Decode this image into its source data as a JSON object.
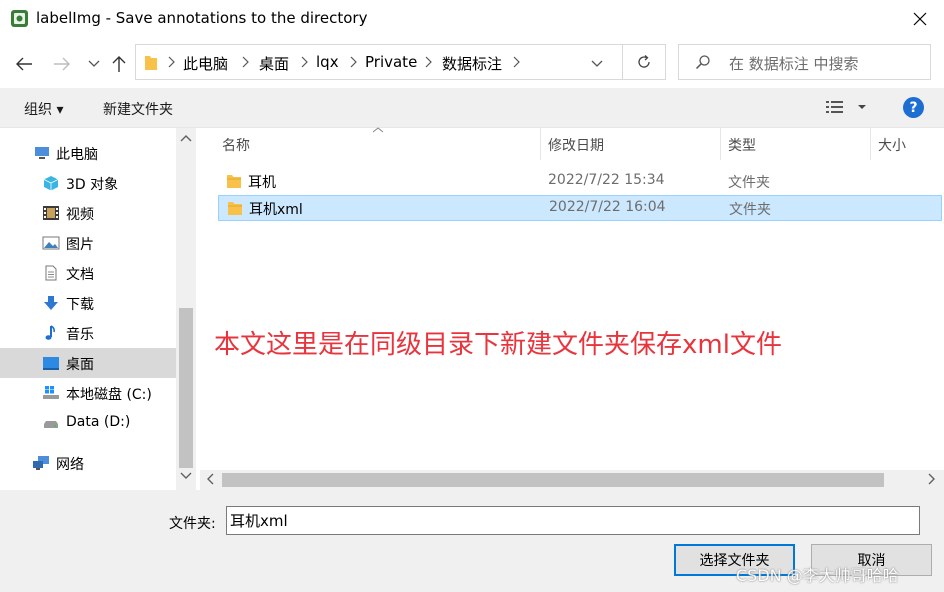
{
  "window": {
    "title": "labelImg - Save annotations to the directory",
    "app_icon": "labelimg-app-icon",
    "close_icon": "close-icon"
  },
  "navigation": {
    "back_icon": "arrow-left-icon",
    "forward_icon": "arrow-right-icon",
    "history_icon": "chevron-down-icon",
    "up_icon": "arrow-up-icon",
    "breadcrumbs": [
      "此电脑",
      "桌面",
      "lqx",
      "Private",
      "数据标注"
    ],
    "refresh_icon": "refresh-icon",
    "search_placeholder": "在 数据标注 中搜索"
  },
  "toolbar": {
    "organize": "组织 ▾",
    "new_folder": "新建文件夹",
    "help": "?"
  },
  "sidebar": {
    "items": [
      {
        "label": "此电脑",
        "icon": "computer-icon"
      },
      {
        "label": "3D 对象",
        "icon": "cube-icon"
      },
      {
        "label": "视频",
        "icon": "film-icon"
      },
      {
        "label": "图片",
        "icon": "picture-icon"
      },
      {
        "label": "文档",
        "icon": "document-icon"
      },
      {
        "label": "下载",
        "icon": "download-icon"
      },
      {
        "label": "音乐",
        "icon": "music-icon"
      },
      {
        "label": "桌面",
        "icon": "desktop-icon"
      },
      {
        "label": "本地磁盘 (C:)",
        "icon": "windows-drive-icon"
      },
      {
        "label": "Data (D:)",
        "icon": "drive-icon"
      },
      {
        "label": "网络",
        "icon": "network-icon"
      }
    ]
  },
  "file_list": {
    "columns": [
      "名称",
      "修改日期",
      "类型",
      "大小"
    ],
    "rows": [
      {
        "name": "耳机",
        "date": "2022/7/22 15:34",
        "type": "文件夹"
      },
      {
        "name": "耳机xml",
        "date": "2022/7/22 16:04",
        "type": "文件夹"
      }
    ],
    "annotation": "本文这里是在同级目录下新建文件夹保存xml文件"
  },
  "footer": {
    "folder_label": "文件夹:",
    "folder_value": "耳机xml",
    "select_button": "选择文件夹",
    "cancel_button": "取消",
    "watermark": "CSDN @李大帅哥哈哈"
  },
  "colors": {
    "accent": "#0078d7",
    "selection": "#cce8ff",
    "annotation": "#e8343d",
    "folder": "#f8c24a"
  }
}
